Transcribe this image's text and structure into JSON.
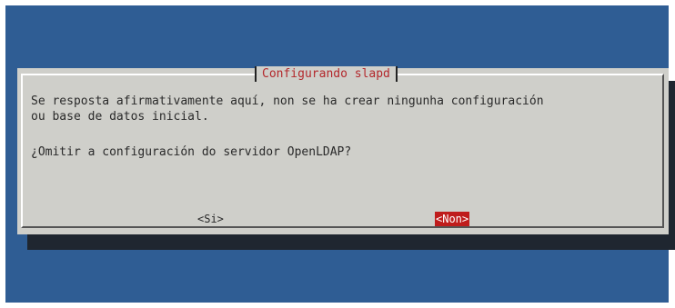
{
  "dialog": {
    "title": "Configurando slapd",
    "message_line1": "Se resposta afirmativamente aquí, non se ha crear ningunha configuración",
    "message_line2": "ou base de datos inicial.",
    "question": "¿Omitir a configuración do servidor OpenLDAP?",
    "yes_label": "<Si>",
    "no_label": "<Non>"
  },
  "colors": {
    "background": "#2f5d94",
    "dialog": "#cfcfca",
    "title_text": "#b3282c",
    "selected_button": "#bf1c1c"
  }
}
